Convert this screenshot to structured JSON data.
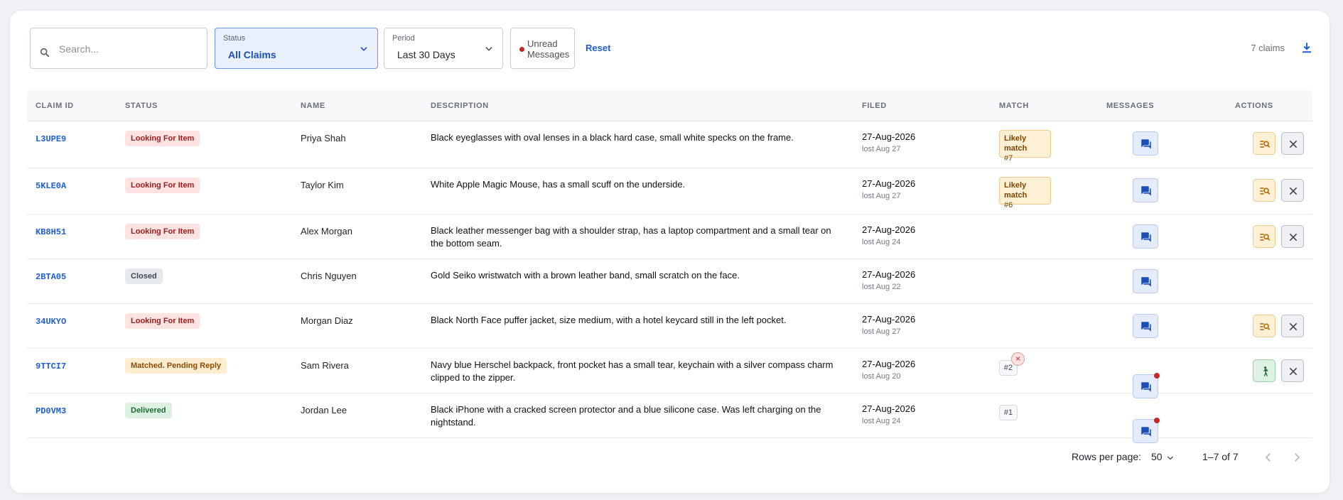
{
  "toolbar": {
    "search_placeholder": "Search...",
    "status_label": "Status",
    "status_value": "All Claims",
    "period_label": "Period",
    "period_value": "Last 30 Days",
    "unread_label": "Unread Messages",
    "reset_label": "Reset",
    "claims_count": "7 claims"
  },
  "columns": [
    "CLAIM ID",
    "STATUS",
    "NAME",
    "DESCRIPTION",
    "FILED",
    "MATCH",
    "MESSAGES",
    "ACTIONS"
  ],
  "rows": [
    {
      "id": "L3UPE9",
      "status": "Looking For Item",
      "status_kind": "looking",
      "name": "Priya Shah",
      "desc": "Black eyeglasses with oval lenses in a black hard case, small white specks on the frame.",
      "filed": "27-Aug-2026",
      "lost": "lost Aug 27",
      "match_kind": "likely",
      "match_title": "Likely match",
      "match_num": "#7",
      "unread": false,
      "actions": [
        "search",
        "close"
      ]
    },
    {
      "id": "5KLE0A",
      "status": "Looking For Item",
      "status_kind": "looking",
      "name": "Taylor Kim",
      "desc": "White Apple Magic Mouse, has a small scuff on the underside.",
      "filed": "27-Aug-2026",
      "lost": "lost Aug 27",
      "match_kind": "likely",
      "match_title": "Likely match",
      "match_num": "#6",
      "unread": false,
      "actions": [
        "search",
        "close"
      ]
    },
    {
      "id": "KB8H51",
      "status": "Looking For Item",
      "status_kind": "looking",
      "name": "Alex Morgan",
      "desc": "Black leather messenger bag with a shoulder strap, has a laptop compartment and a small tear on the bottom seam.",
      "filed": "27-Aug-2026",
      "lost": "lost Aug 24",
      "match_kind": "none",
      "match_title": "",
      "match_num": "",
      "unread": false,
      "actions": [
        "search",
        "close"
      ]
    },
    {
      "id": "2BTA05",
      "status": "Closed",
      "status_kind": "closed",
      "name": "Chris Nguyen",
      "desc": "Gold Seiko wristwatch with a brown leather band, small scratch on the face.",
      "filed": "27-Aug-2026",
      "lost": "lost Aug 22",
      "match_kind": "none",
      "match_title": "",
      "match_num": "",
      "unread": false,
      "actions": []
    },
    {
      "id": "34UKYO",
      "status": "Looking For Item",
      "status_kind": "looking",
      "name": "Morgan Diaz",
      "desc": "Black North Face puffer jacket, size medium, with a hotel keycard still in the left pocket.",
      "filed": "27-Aug-2026",
      "lost": "lost Aug 27",
      "match_kind": "none",
      "match_title": "",
      "match_num": "",
      "unread": false,
      "actions": [
        "search",
        "close"
      ]
    },
    {
      "id": "9TTCI7",
      "status": "Matched. Pending Reply",
      "status_kind": "matched",
      "name": "Sam Rivera",
      "desc": "Navy blue Herschel backpack, front pocket has a small tear, keychain with a silver compass charm clipped to the zipper.",
      "filed": "27-Aug-2026",
      "lost": "lost Aug 20",
      "match_kind": "pill-x",
      "match_title": "",
      "match_num": "#2",
      "unread": true,
      "actions": [
        "walk",
        "close"
      ]
    },
    {
      "id": "PD0VM3",
      "status": "Delivered",
      "status_kind": "delivered",
      "name": "Jordan Lee",
      "desc": "Black iPhone with a cracked screen protector and a blue silicone case. Was left charging on the nightstand.",
      "filed": "27-Aug-2026",
      "lost": "lost Aug 24",
      "match_kind": "pill",
      "match_title": "",
      "match_num": "#1",
      "unread": true,
      "actions": []
    }
  ],
  "footer": {
    "rows_per_page_label": "Rows per page:",
    "rows_per_page_value": "50",
    "range": "1–7 of 7"
  },
  "colors": {
    "accent": "#1f5fd1",
    "danger": "#c62828"
  }
}
